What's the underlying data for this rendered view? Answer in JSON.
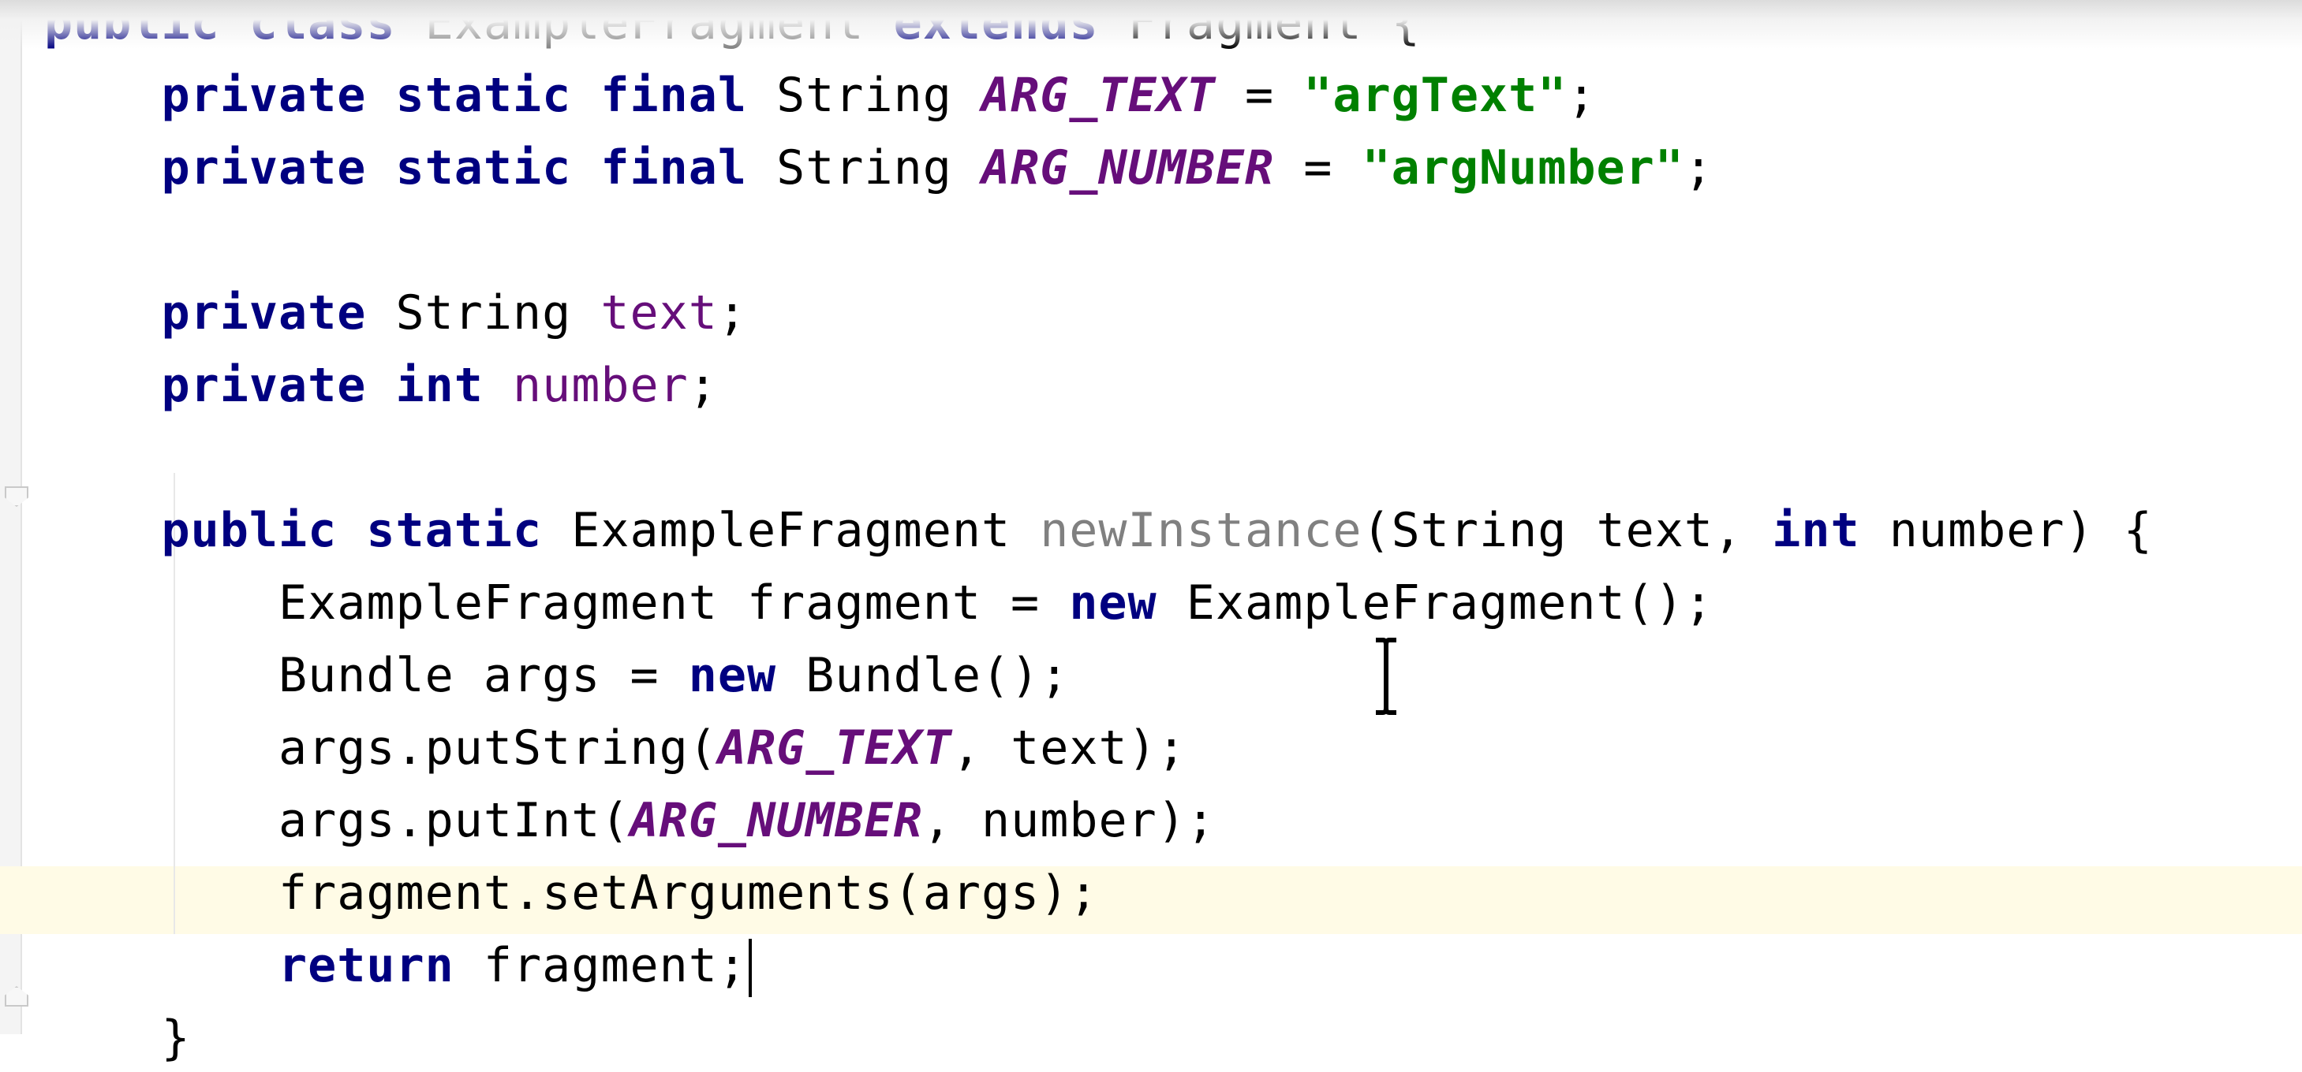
{
  "editor": {
    "lines": [
      {
        "parts": [
          {
            "text": "public class ",
            "cls": "kw"
          },
          {
            "text": "ExampleFragment",
            "cls": "unused"
          },
          {
            "text": " ",
            "cls": ""
          },
          {
            "text": "extends",
            "cls": "kw"
          },
          {
            "text": " Fragment {",
            "cls": ""
          }
        ]
      },
      {
        "parts": [
          {
            "text": "    private static final ",
            "cls": "kw"
          },
          {
            "text": "String ",
            "cls": ""
          },
          {
            "text": "ARG_TEXT",
            "cls": "const"
          },
          {
            "text": " = ",
            "cls": ""
          },
          {
            "text": "\"argText\"",
            "cls": "str"
          },
          {
            "text": ";",
            "cls": ""
          }
        ]
      },
      {
        "parts": [
          {
            "text": "    private static final ",
            "cls": "kw"
          },
          {
            "text": "String ",
            "cls": ""
          },
          {
            "text": "ARG_NUMBER",
            "cls": "const"
          },
          {
            "text": " = ",
            "cls": ""
          },
          {
            "text": "\"argNumber\"",
            "cls": "str"
          },
          {
            "text": ";",
            "cls": ""
          }
        ]
      },
      {
        "parts": []
      },
      {
        "parts": [
          {
            "text": "    private ",
            "cls": "kw"
          },
          {
            "text": "String ",
            "cls": ""
          },
          {
            "text": "text",
            "cls": "field"
          },
          {
            "text": ";",
            "cls": ""
          }
        ]
      },
      {
        "parts": [
          {
            "text": "    private int ",
            "cls": "kw"
          },
          {
            "text": "number",
            "cls": "field"
          },
          {
            "text": ";",
            "cls": ""
          }
        ]
      },
      {
        "parts": []
      },
      {
        "parts": [
          {
            "text": "    public static ",
            "cls": "kw"
          },
          {
            "text": "ExampleFragment ",
            "cls": ""
          },
          {
            "text": "newInstance",
            "cls": "unused"
          },
          {
            "text": "(String text, ",
            "cls": ""
          },
          {
            "text": "int",
            "cls": "kw"
          },
          {
            "text": " number) {",
            "cls": ""
          }
        ]
      },
      {
        "parts": [
          {
            "text": "        ExampleFragment fragment = ",
            "cls": ""
          },
          {
            "text": "new",
            "cls": "kw"
          },
          {
            "text": " ExampleFragment();",
            "cls": ""
          }
        ]
      },
      {
        "parts": [
          {
            "text": "        Bundle args = ",
            "cls": ""
          },
          {
            "text": "new",
            "cls": "kw"
          },
          {
            "text": " Bundle();",
            "cls": ""
          }
        ]
      },
      {
        "parts": [
          {
            "text": "        args.putString(",
            "cls": ""
          },
          {
            "text": "ARG_TEXT",
            "cls": "const"
          },
          {
            "text": ", text);",
            "cls": ""
          }
        ]
      },
      {
        "parts": [
          {
            "text": "        args.putInt(",
            "cls": ""
          },
          {
            "text": "ARG_NUMBER",
            "cls": "const"
          },
          {
            "text": ", number);",
            "cls": ""
          }
        ]
      },
      {
        "parts": [
          {
            "text": "        fragment.setArguments(args);",
            "cls": ""
          }
        ]
      },
      {
        "parts": [
          {
            "text": "        return",
            "cls": "kw"
          },
          {
            "text": " fragment;",
            "cls": ""
          }
        ],
        "caret": true
      },
      {
        "parts": [
          {
            "text": "    }",
            "cls": ""
          }
        ]
      }
    ]
  },
  "colors": {
    "keyword": "#000080",
    "constant": "#660e7a",
    "string": "#008000",
    "unused": "#808080",
    "caret_line": "#fffbe6"
  },
  "icons": {
    "fold_open": "fold-open-icon",
    "fold_close": "fold-close-icon",
    "mouse_cursor": "text-cursor-icon"
  }
}
